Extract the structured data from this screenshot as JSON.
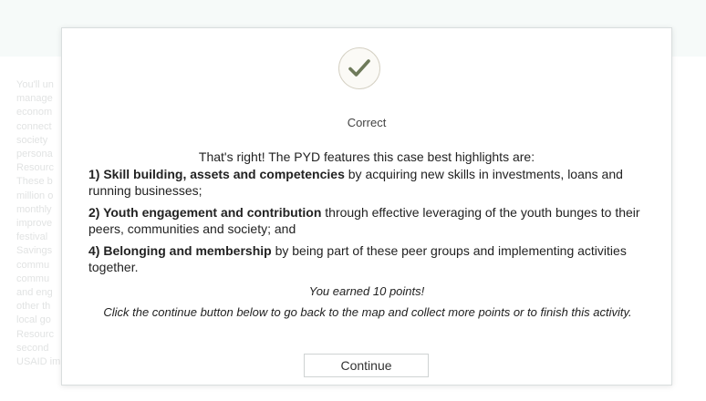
{
  "background": {
    "lines": [
      "You'll un",
      "manage",
      "econom",
      "connect",
      "society",
      "persona",
      "Resourc",
      "These b",
      "million o",
      "monthly",
      "improve",
      "festival",
      "Savings",
      "commu",
      "commu",
      "and eng",
      "other th",
      "local go",
      "Resourc",
      "second",
      "USAID implementing partner."
    ]
  },
  "modal": {
    "status": "Correct",
    "intro": "That's right! The PYD features this case best highlights are:",
    "points": [
      {
        "bold": "1) Skill building, assets and competencies",
        "rest": " by acquiring new skills in investments, loans and running businesses;"
      },
      {
        "bold": "2) Youth engagement and contribution",
        "rest": " through effective leveraging of the youth bunges to their peers, communities and society; and"
      },
      {
        "bold": "4) Belonging and membership",
        "rest": " by being part of these peer groups and implementing activities together."
      }
    ],
    "earned": "You earned 10 points!",
    "instruction": "Click the continue button below to go back to the map and collect more points or to finish this activity.",
    "continue_label": "Continue",
    "check_color": "#6e7a5a"
  }
}
